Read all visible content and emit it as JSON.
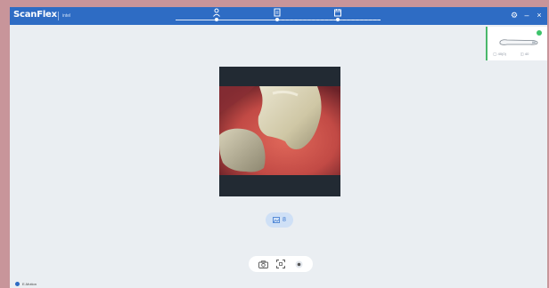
{
  "app": {
    "name": "ScanFlex",
    "version": "intel"
  },
  "steps": [
    {
      "name": "patient",
      "icon": "user-icon"
    },
    {
      "name": "order",
      "icon": "document-icon"
    },
    {
      "name": "scan",
      "icon": "calendar-icon"
    }
  ],
  "window": {
    "settings_glyph": "⚙",
    "minimize_glyph": "–",
    "close_glyph": "×"
  },
  "scanner": {
    "stat_left": "◯ 40(0)",
    "stat_right": "◫ 40",
    "status_color": "#3cc36a"
  },
  "gallery": {
    "count": "8"
  },
  "status_bar": {
    "label": "E-Motion"
  },
  "colors": {
    "brand": "#2e6cc4",
    "accent": "#3cc36a",
    "frame": "#c8959a"
  }
}
